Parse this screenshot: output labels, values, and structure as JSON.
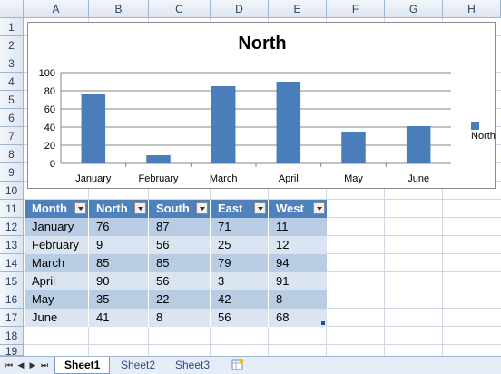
{
  "columns": [
    "A",
    "B",
    "C",
    "D",
    "E",
    "F",
    "G",
    "H"
  ],
  "rows": [
    "1",
    "2",
    "3",
    "4",
    "5",
    "6",
    "7",
    "8",
    "9",
    "10",
    "11",
    "12",
    "13",
    "14",
    "15",
    "16",
    "17",
    "18",
    "19"
  ],
  "chart_data": {
    "type": "bar",
    "title": "North",
    "categories": [
      "January",
      "February",
      "March",
      "April",
      "May",
      "June"
    ],
    "series": [
      {
        "name": "North",
        "values": [
          76,
          9,
          85,
          90,
          35,
          41
        ]
      }
    ],
    "ylim": [
      0,
      100
    ],
    "yticks": [
      "0",
      "20",
      "40",
      "60",
      "80",
      "100"
    ],
    "grid": true,
    "legend": "right",
    "color": "#4a7ebb"
  },
  "table": {
    "headers": [
      "Month",
      "North",
      "South",
      "East",
      "West"
    ],
    "rows": [
      [
        "January",
        "76",
        "87",
        "71",
        "11"
      ],
      [
        "February",
        "9",
        "56",
        "25",
        "12"
      ],
      [
        "March",
        "85",
        "85",
        "79",
        "94"
      ],
      [
        "April",
        "90",
        "56",
        "3",
        "91"
      ],
      [
        "May",
        "35",
        "22",
        "42",
        "8"
      ],
      [
        "June",
        "41",
        "8",
        "56",
        "68"
      ]
    ]
  },
  "sheets": [
    "Sheet1",
    "Sheet2",
    "Sheet3"
  ],
  "active_sheet": "Sheet1"
}
